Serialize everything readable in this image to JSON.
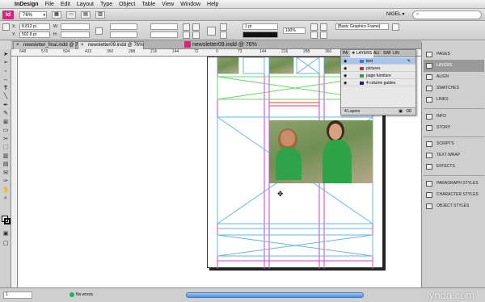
{
  "menubar": {
    "app": "InDesign",
    "items": [
      "File",
      "Edit",
      "Layout",
      "Type",
      "Object",
      "Table",
      "View",
      "Window",
      "Help"
    ]
  },
  "appbar": {
    "logo": "Id",
    "zoom": "76%",
    "workspace": "NIGEL",
    "search_placeholder": ""
  },
  "control": {
    "x_label": "X:",
    "x_value": "8.812 pi",
    "y_label": "Y:",
    "y_value": "502.8 pt",
    "w_label": "W:",
    "h_label": "H:",
    "stroke_weight": "1 pt",
    "zoom_pct": "100%",
    "frame_style": "[Basic Graphics Frame]"
  },
  "doctabs": {
    "tab1": "newsletter_final.indd @ 76%",
    "tab2": "newsletter09.indd @ 76%"
  },
  "window_title": "newsletter09.indd @ 76%",
  "ruler": {
    "numbers": [
      "648",
      "576",
      "504",
      "432",
      "360",
      "288",
      "216",
      "144",
      "72",
      "0",
      "72",
      "144",
      "216",
      "288",
      "360",
      "432",
      "504",
      "576",
      "648"
    ]
  },
  "layers": {
    "tabs": [
      "PA",
      "❖ LAYERS",
      "ALI",
      "SWI",
      "LIN"
    ],
    "rows": [
      {
        "name": "text",
        "color": "#3c78d8",
        "selected": true
      },
      {
        "name": "pictures",
        "color": "#d52a2a",
        "selected": false
      },
      {
        "name": "page furniture",
        "color": "#2aa52a",
        "selected": false
      },
      {
        "name": "4 column guides",
        "color": "#1a1aa0",
        "selected": false
      }
    ],
    "footer": "4 Layers"
  },
  "dock": {
    "items": [
      {
        "label": "PAGES",
        "icon": "pages-icon",
        "active": false
      },
      {
        "label": "LAYERS",
        "icon": "layers-icon",
        "active": true
      },
      {
        "label": "ALIGN",
        "icon": "align-icon",
        "active": false
      },
      {
        "label": "SWATCHES",
        "icon": "swatches-icon",
        "active": false
      },
      {
        "label": "LINKS",
        "icon": "links-icon",
        "active": false
      },
      {
        "label": "INFO",
        "icon": "info-icon",
        "active": false
      },
      {
        "label": "STORY",
        "icon": "story-icon",
        "active": false
      },
      {
        "label": "SCRIPTS",
        "icon": "scripts-icon",
        "active": false
      },
      {
        "label": "TEXT WRAP",
        "icon": "text-wrap-icon",
        "active": false
      },
      {
        "label": "EFFECTS",
        "icon": "effects-icon",
        "active": false
      },
      {
        "label": "PARAGRAPH STYLES",
        "icon": "paragraph-styles-icon",
        "active": false
      },
      {
        "label": "CHARACTER STYLES",
        "icon": "character-styles-icon",
        "active": false
      },
      {
        "label": "OBJECT STYLES",
        "icon": "object-styles-icon",
        "active": false
      }
    ]
  },
  "status": {
    "page": "1",
    "errors": "No errors",
    "watermark": "lynda.com"
  },
  "colors": {
    "accent": "#d4247b",
    "guide_magenta": "#cc44cc",
    "guide_cyan": "#66b7e8",
    "guide_green": "#66d866",
    "guide_red": "#e04040"
  }
}
